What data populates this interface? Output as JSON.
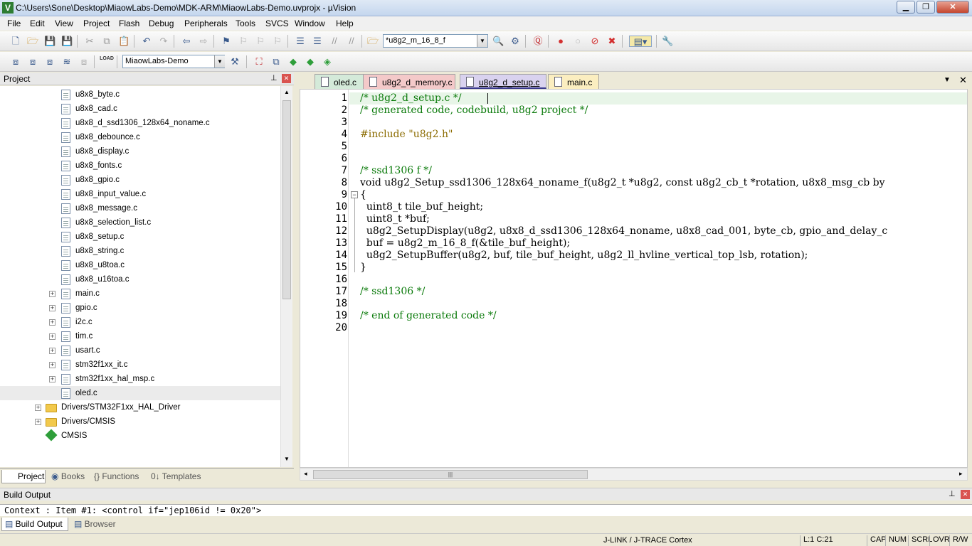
{
  "window": {
    "title": "C:\\Users\\Sone\\Desktop\\MiaowLabs-Demo\\MDK-ARM\\MiaowLabs-Demo.uvprojx - µVision",
    "icon_letter": "V",
    "minimize": "▁",
    "maximize": "❐",
    "close": "✕"
  },
  "menu": [
    "File",
    "Edit",
    "View",
    "Project",
    "Flash",
    "Debug",
    "Peripherals",
    "Tools",
    "SVCS",
    "Window",
    "Help"
  ],
  "toolbar": {
    "find_combo_value": "*u8g2_m_16_8_f",
    "target_combo_value": "MiaowLabs-Demo",
    "load_label": "LOAD"
  },
  "project": {
    "header": "Project",
    "pin_icon": "⊥",
    "close_icon": "✕",
    "files": [
      "u8x8_byte.c",
      "u8x8_cad.c",
      "u8x8_d_ssd1306_128x64_noname.c",
      "u8x8_debounce.c",
      "u8x8_display.c",
      "u8x8_fonts.c",
      "u8x8_gpio.c",
      "u8x8_input_value.c",
      "u8x8_message.c",
      "u8x8_selection_list.c",
      "u8x8_setup.c",
      "u8x8_string.c",
      "u8x8_u8toa.c",
      "u8x8_u16toa.c"
    ],
    "expandable_files": [
      "main.c",
      "gpio.c",
      "i2c.c",
      "tim.c",
      "usart.c",
      "stm32f1xx_it.c",
      "stm32f1xx_hal_msp.c"
    ],
    "selected_file": "oled.c",
    "groups": [
      "Drivers/STM32F1xx_HAL_Driver",
      "Drivers/CMSIS"
    ],
    "cmsis": "CMSIS",
    "tabs": [
      "Project",
      "Books",
      "{} Functions",
      "0↓ Templates"
    ]
  },
  "editor": {
    "tabs": [
      {
        "label": "oled.c",
        "color": "#d4ead9"
      },
      {
        "label": "u8g2_d_memory.c",
        "color": "#f4c9c9"
      },
      {
        "label": "u8g2_d_setup.c",
        "color": "#d9d2ef"
      },
      {
        "label": "main.c",
        "color": "#fbeec0"
      }
    ],
    "active_tab": 2,
    "line_numbers": [
      "1",
      "2",
      "3",
      "4",
      "5",
      "6",
      "7",
      "8",
      "9",
      "10",
      "11",
      "12",
      "13",
      "14",
      "15",
      "16",
      "17",
      "18",
      "19",
      "20"
    ],
    "lines": [
      "/* u8g2_d_setup.c */",
      "/* generated code, codebuild, u8g2 project */",
      "",
      "#include \"u8g2.h\"",
      "",
      "",
      "/* ssd1306 f */",
      "void u8g2_Setup_ssd1306_128x64_noname_f(u8g2_t *u8g2, const u8g2_cb_t *rotation, u8x8_msg_cb by",
      "{",
      "  uint8_t tile_buf_height;",
      "  uint8_t *buf;",
      "  u8g2_SetupDisplay(u8g2, u8x8_d_ssd1306_128x64_noname, u8x8_cad_001, byte_cb, gpio_and_delay_c",
      "  buf = u8g2_m_16_8_f(&tile_buf_height);",
      "  u8g2_SetupBuffer(u8g2, buf, tile_buf_height, u8g2_ll_hvline_vertical_top_lsb, rotation);",
      "}",
      "",
      "/* ssd1306 */",
      "",
      "/* end of generated code */",
      ""
    ],
    "fold_marker": "⊟",
    "hscroll_grip": "|||"
  },
  "build_output": {
    "header": "Build Output",
    "content": "Context       : Item #1: <control if=\"jep106id != 0x20\">",
    "tabs": [
      "Build Output",
      "Browser"
    ]
  },
  "status": {
    "debugger": "J-LINK / J-TRACE Cortex",
    "position": "L:1 C:21",
    "cap": "CAP",
    "num": "NUM",
    "scrl": "SCRL",
    "ovr": "OVR",
    "rw": "R/W"
  }
}
